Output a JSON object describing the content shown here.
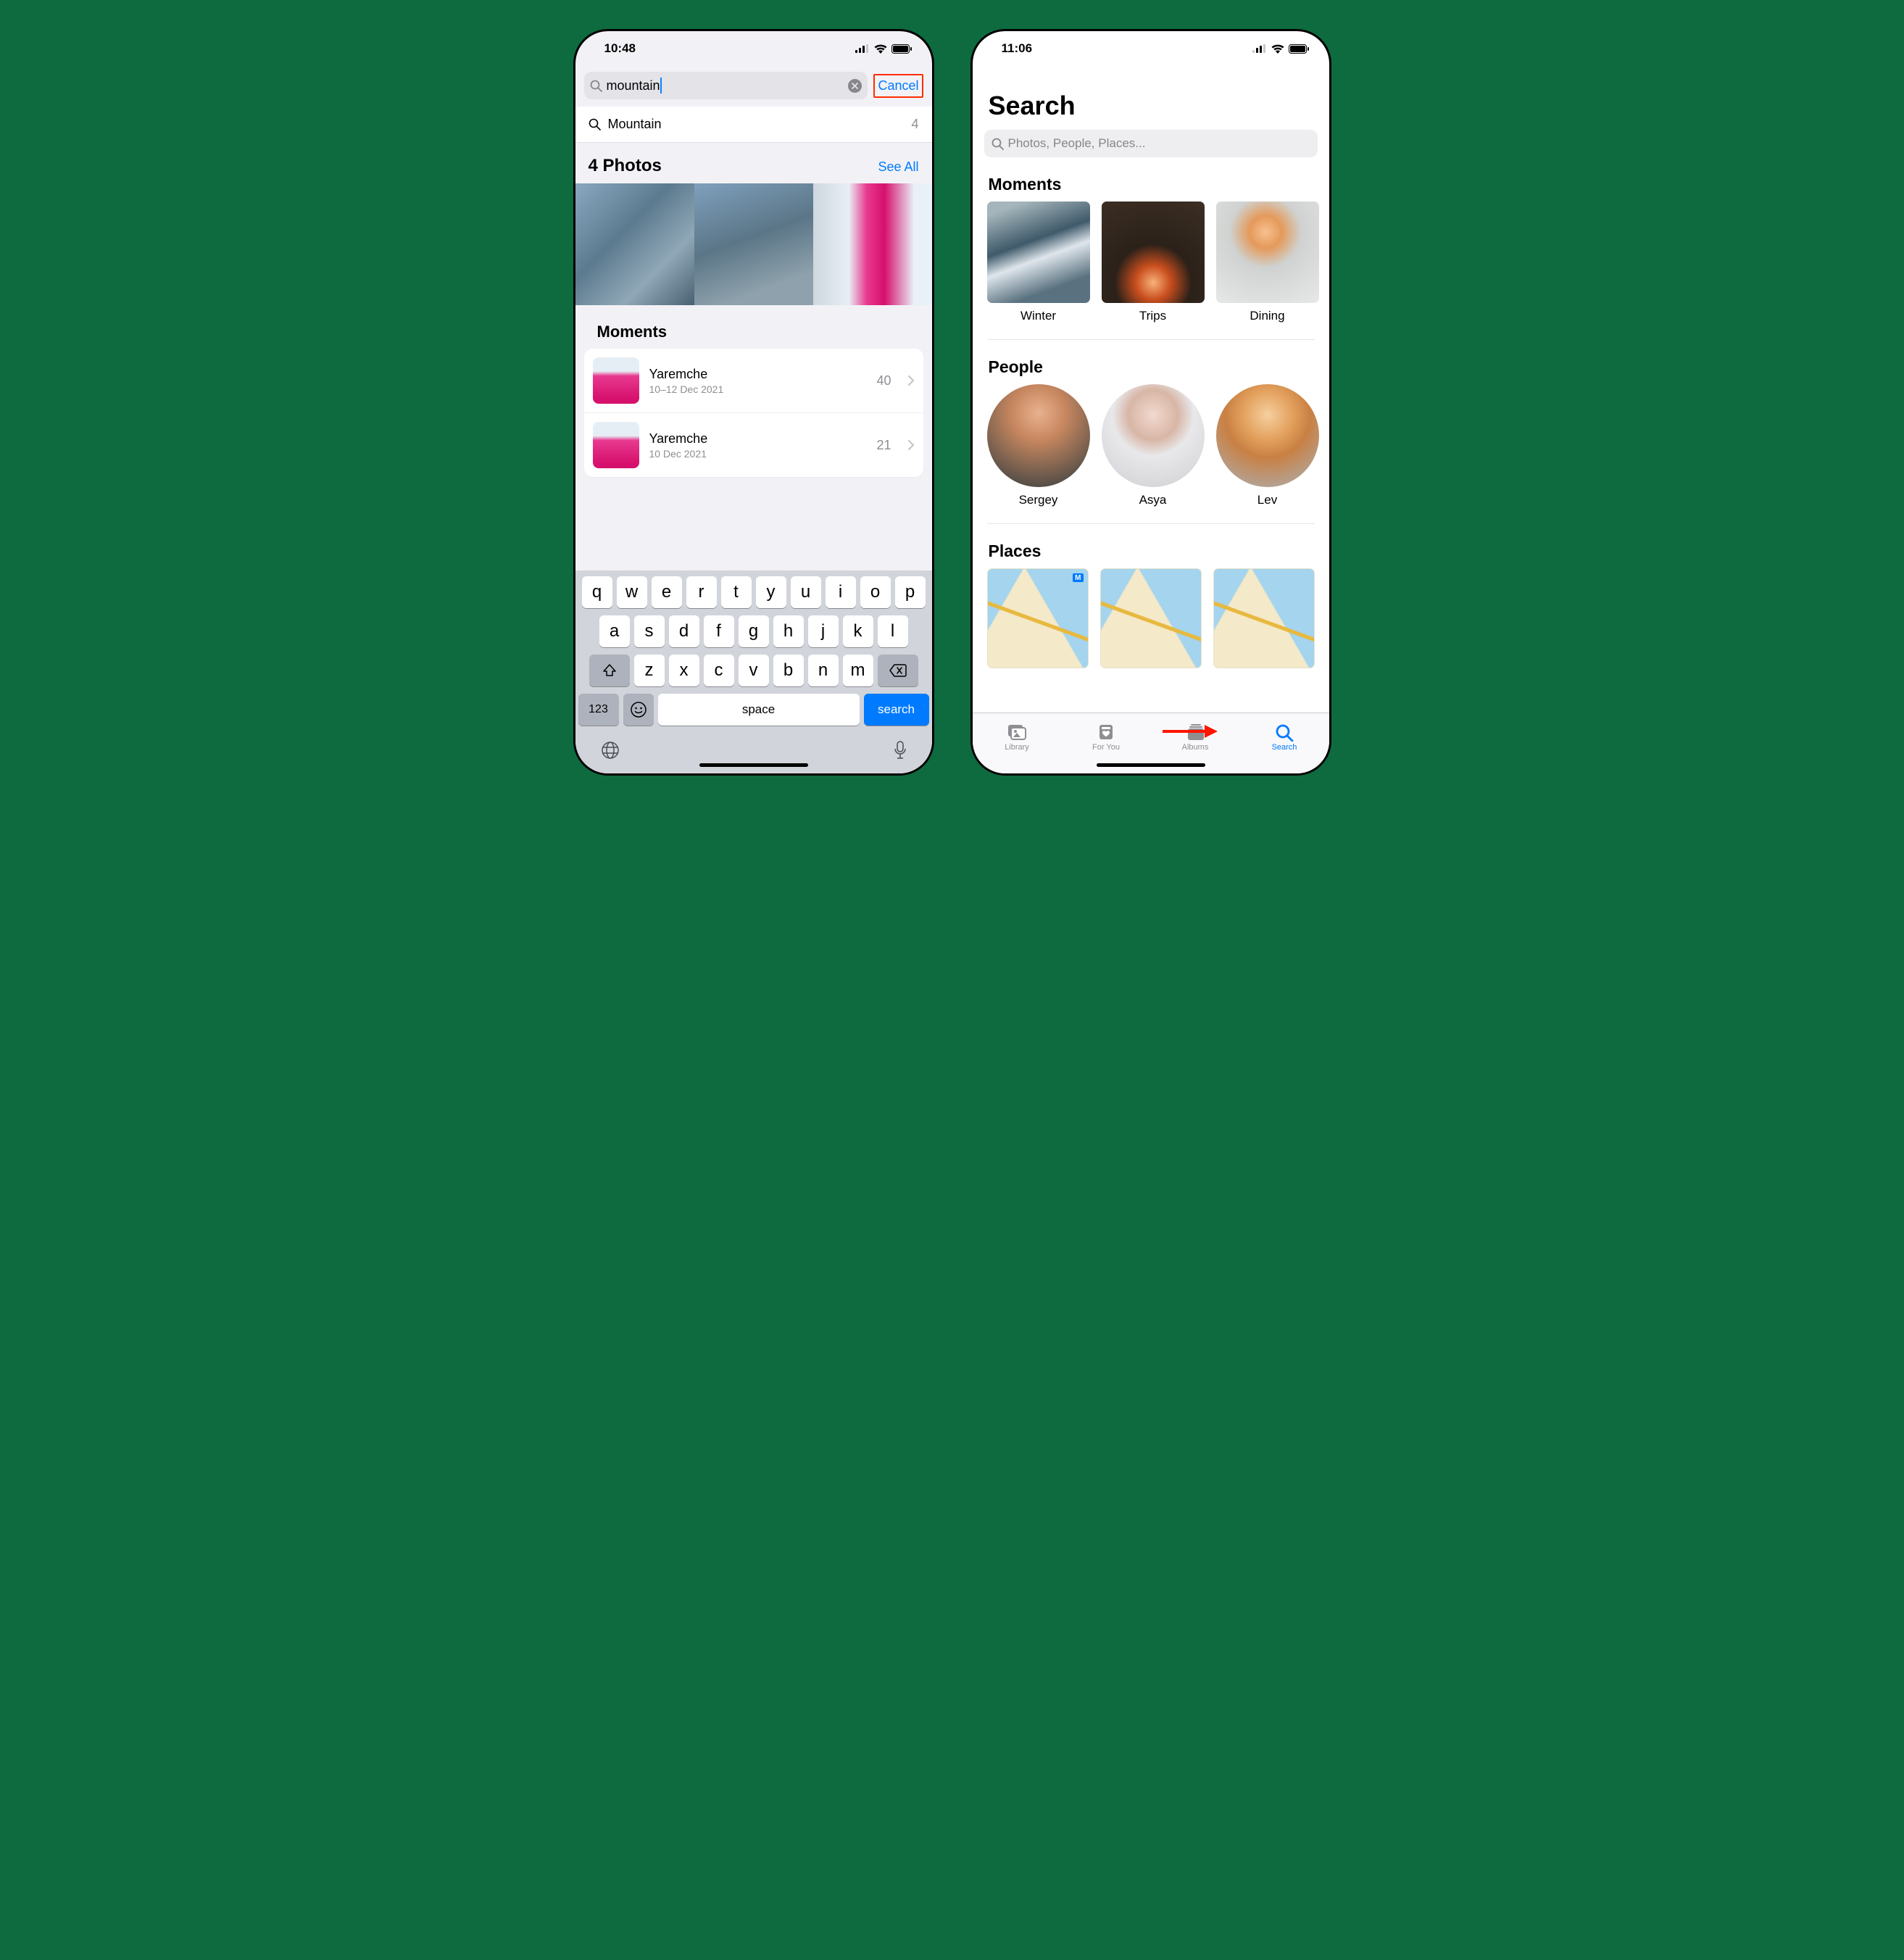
{
  "left": {
    "status_time": "10:48",
    "search_value": "mountain",
    "cancel_label": "Cancel",
    "suggestion": {
      "label": "Mountain",
      "count": "4"
    },
    "photos_header": "4 Photos",
    "see_all": "See All",
    "moments_header": "Moments",
    "moments": [
      {
        "title": "Yaremche",
        "subtitle": "10–12 Dec 2021",
        "count": "40"
      },
      {
        "title": "Yaremche",
        "subtitle": "10 Dec 2021",
        "count": "21"
      }
    ],
    "keyboard": {
      "row1": [
        "q",
        "w",
        "e",
        "r",
        "t",
        "y",
        "u",
        "i",
        "o",
        "p"
      ],
      "row2": [
        "a",
        "s",
        "d",
        "f",
        "g",
        "h",
        "j",
        "k",
        "l"
      ],
      "row3": [
        "z",
        "x",
        "c",
        "v",
        "b",
        "n",
        "m"
      ],
      "numkey": "123",
      "space": "space",
      "search": "search"
    }
  },
  "right": {
    "status_time": "11:06",
    "title": "Search",
    "search_placeholder": "Photos, People, Places...",
    "moments_header": "Moments",
    "moments": [
      "Winter",
      "Trips",
      "Dining"
    ],
    "people_header": "People",
    "people": [
      "Sergey",
      "Asya",
      "Lev"
    ],
    "places_header": "Places",
    "map_badge": "M",
    "tabs": {
      "library": "Library",
      "foryou": "For You",
      "albums": "Albums",
      "search": "Search"
    }
  }
}
